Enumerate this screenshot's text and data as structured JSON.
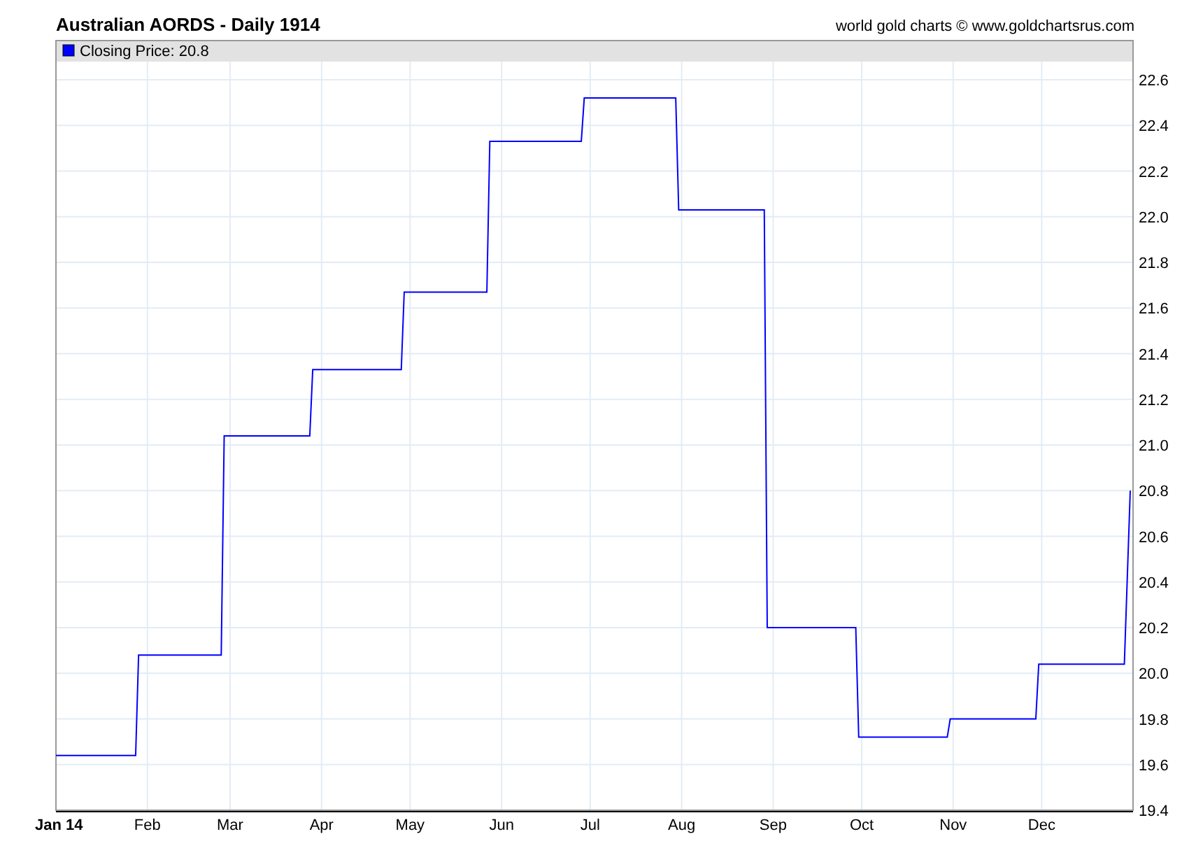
{
  "header": {
    "title": "Australian AORDS - Daily 1914",
    "credit": "world gold charts © www.goldchartsrus.com"
  },
  "chart": {
    "legend": {
      "label": "Closing Price: 20.8"
    },
    "chart_data": {
      "type": "line",
      "x": [
        "1914-01-01",
        "1914-01-28",
        "1914-01-29",
        "1914-02-26",
        "1914-02-27",
        "1914-03-28",
        "1914-03-29",
        "1914-04-28",
        "1914-04-29",
        "1914-05-27",
        "1914-05-28",
        "1914-06-28",
        "1914-06-29",
        "1914-07-30",
        "1914-07-31",
        "1914-08-29",
        "1914-08-30",
        "1914-09-29",
        "1914-09-30",
        "1914-10-30",
        "1914-10-31",
        "1914-11-29",
        "1914-11-30",
        "1914-12-29",
        "1914-12-31"
      ],
      "series": [
        {
          "color": "#0000ff",
          "values": [
            19.64,
            19.64,
            20.08,
            20.08,
            21.04,
            21.04,
            21.33,
            21.33,
            21.67,
            21.67,
            22.33,
            22.33,
            22.52,
            22.52,
            22.03,
            22.03,
            20.2,
            20.2,
            19.72,
            19.72,
            19.8,
            19.8,
            20.04,
            20.04,
            20.8
          ]
        }
      ],
      "xlim": [
        "1914-01-01",
        "1914-12-31"
      ],
      "ylim": [
        19.4,
        22.6
      ],
      "grid": true,
      "xticks": [
        {
          "value": "1914-01-01",
          "label": "Jan 14"
        },
        {
          "value": "1914-02-01",
          "label": "Feb"
        },
        {
          "value": "1914-03-01",
          "label": "Mar"
        },
        {
          "value": "1914-04-01",
          "label": "Apr"
        },
        {
          "value": "1914-05-01",
          "label": "May"
        },
        {
          "value": "1914-06-01",
          "label": "Jun"
        },
        {
          "value": "1914-07-01",
          "label": "Jul"
        },
        {
          "value": "1914-08-01",
          "label": "Aug"
        },
        {
          "value": "1914-09-01",
          "label": "Sep"
        },
        {
          "value": "1914-10-01",
          "label": "Oct"
        },
        {
          "value": "1914-11-01",
          "label": "Nov"
        },
        {
          "value": "1914-12-01",
          "label": "Dec"
        }
      ],
      "yticks": [
        {
          "value": 19.4,
          "label": "19.4"
        },
        {
          "value": 19.6,
          "label": "19.6"
        },
        {
          "value": 19.8,
          "label": "19.8"
        },
        {
          "value": 20.0,
          "label": "20.0"
        },
        {
          "value": 20.2,
          "label": "20.2"
        },
        {
          "value": 20.4,
          "label": "20.4"
        },
        {
          "value": 20.6,
          "label": "20.6"
        },
        {
          "value": 20.8,
          "label": "20.8"
        },
        {
          "value": 21.0,
          "label": "21.0"
        },
        {
          "value": 21.2,
          "label": "21.2"
        },
        {
          "value": 21.4,
          "label": "21.4"
        },
        {
          "value": 21.6,
          "label": "21.6"
        },
        {
          "value": 21.8,
          "label": "21.8"
        },
        {
          "value": 22.0,
          "label": "22.0"
        },
        {
          "value": 22.2,
          "label": "22.2"
        },
        {
          "value": 22.4,
          "label": "22.4"
        },
        {
          "value": 22.6,
          "label": "22.6"
        }
      ]
    }
  }
}
